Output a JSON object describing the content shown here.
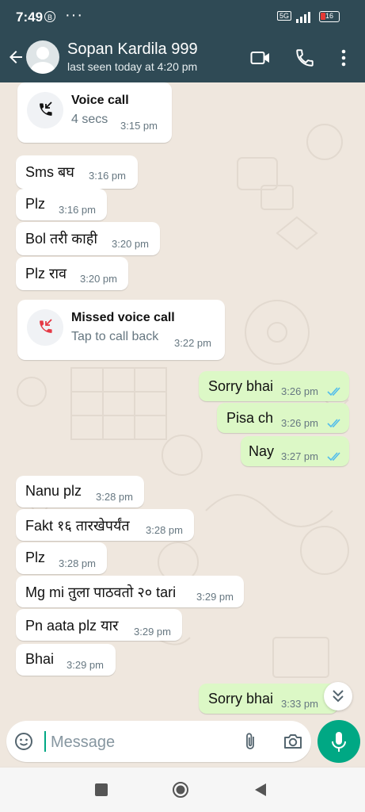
{
  "status_bar": {
    "time": "7:49",
    "b_icon": "B",
    "dots": "···",
    "network_badge": "5G",
    "battery": "16"
  },
  "header": {
    "contact_name": "Sopan Kardila 999",
    "last_seen": "last seen today at 4:20 pm"
  },
  "calls": {
    "voice": {
      "title": "Voice call",
      "subtitle": "4 secs",
      "time": "3:15 pm"
    },
    "missed": {
      "title": "Missed voice call",
      "subtitle": "Tap to call back",
      "time": "3:22 pm"
    }
  },
  "messages": [
    {
      "text": "Sms बघ",
      "time": "3:16 pm"
    },
    {
      "text": "Plz",
      "time": "3:16 pm"
    },
    {
      "text": "Bol तरी काही",
      "time": "3:20 pm"
    },
    {
      "text": "Plz राव",
      "time": "3:20 pm"
    },
    {
      "text": "Sorry bhai",
      "time": "3:26 pm"
    },
    {
      "text": "Pisa ch",
      "time": "3:26 pm"
    },
    {
      "text": "Nay",
      "time": "3:27 pm"
    },
    {
      "text": "Nanu plz",
      "time": "3:28 pm"
    },
    {
      "text": "Fakt १६ तारखेपर्यंत",
      "time": "3:28 pm"
    },
    {
      "text": "Plz",
      "time": "3:28 pm"
    },
    {
      "text": "Mg mi तुला पाठवतो २० tari",
      "time": "3:29 pm"
    },
    {
      "text": "Pn aata plz यार",
      "time": "3:29 pm"
    },
    {
      "text": "Bhai",
      "time": "3:29 pm"
    },
    {
      "text": "Sorry bhai",
      "time": "3:33 pm"
    }
  ],
  "composer": {
    "placeholder": "Message"
  },
  "colors": {
    "header_bg": "#2f4a55",
    "outgoing_bubble": "#dcf8c6",
    "incoming_bubble": "#ffffff",
    "accent": "#00a884",
    "read_ticks": "#53bdeb",
    "missed_call_red": "#e53945"
  }
}
